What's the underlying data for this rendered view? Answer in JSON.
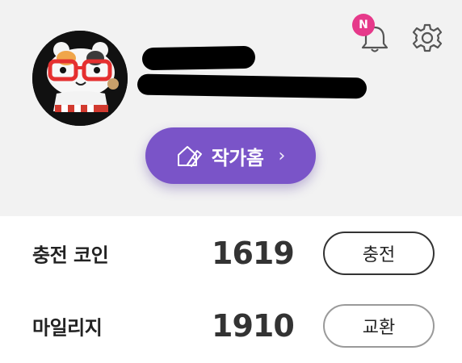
{
  "profile": {
    "avatar_icon": "hamster-avatar",
    "name_redacted": true
  },
  "notifications": {
    "badge": "N",
    "badge_color": "#e6398a",
    "icon": "bell-icon"
  },
  "settings": {
    "icon": "gear-icon"
  },
  "author_home": {
    "label": "작가홈",
    "chevron": "›",
    "bg_color": "#7a54c8"
  },
  "balances": [
    {
      "label": "충전 코인",
      "value": "1619",
      "action": "충전"
    },
    {
      "label": "마일리지",
      "value": "1910",
      "action": "교환"
    }
  ]
}
